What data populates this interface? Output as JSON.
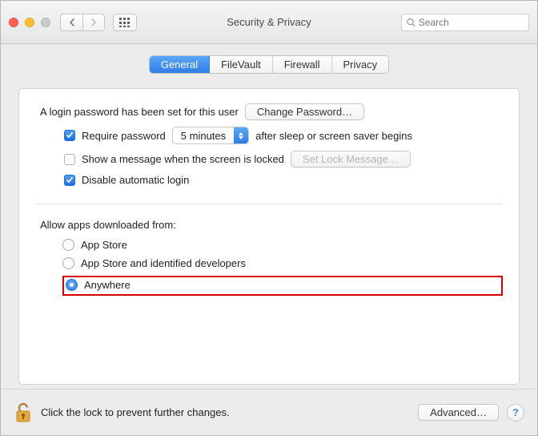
{
  "window": {
    "title": "Security & Privacy"
  },
  "search": {
    "placeholder": "Search"
  },
  "tabs": {
    "general": "General",
    "filevault": "FileVault",
    "firewall": "Firewall",
    "privacy": "Privacy"
  },
  "login": {
    "status": "A login password has been set for this user",
    "change_password": "Change Password…",
    "require_password": "Require password",
    "delay": "5 minutes",
    "after_text": "after sleep or screen saver begins",
    "show_message": "Show a message when the screen is locked",
    "set_lock_message": "Set Lock Message…",
    "disable_auto_login": "Disable automatic login"
  },
  "apps": {
    "heading": "Allow apps downloaded from:",
    "app_store": "App Store",
    "app_store_identified": "App Store and identified developers",
    "anywhere": "Anywhere"
  },
  "footer": {
    "lock_text": "Click the lock to prevent further changes.",
    "advanced": "Advanced…"
  }
}
